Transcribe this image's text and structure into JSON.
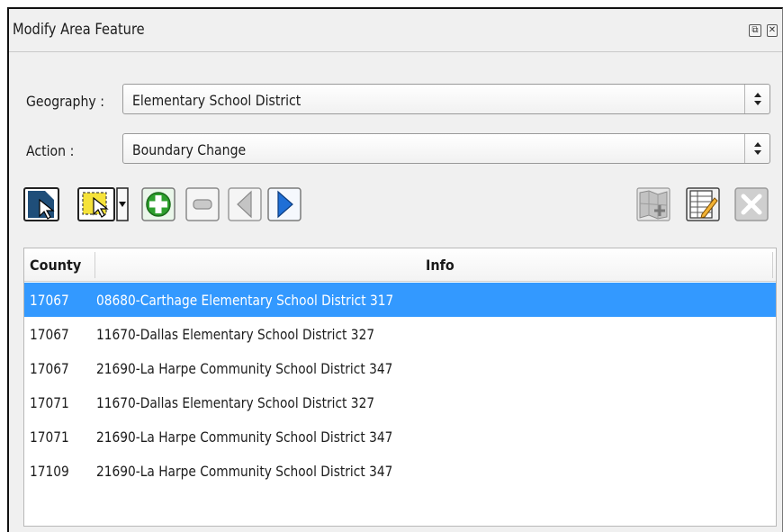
{
  "window": {
    "title": "Modify Area Feature",
    "float_glyph": "⧉",
    "close_glyph": "✕"
  },
  "form": {
    "geography": {
      "label": "Geography :",
      "value": "Elementary School District"
    },
    "action": {
      "label": "Action :",
      "value": "Boundary Change"
    }
  },
  "toolbar": {
    "icons": [
      "select-feature-icon",
      "rectangle-select-icon",
      "dropdown-arrow-icon",
      "add-icon",
      "remove-icon",
      "previous-icon",
      "next-icon",
      "map-edit-icon",
      "table-edit-icon",
      "close-icon"
    ]
  },
  "table": {
    "columns": [
      "County",
      "Info"
    ],
    "rows": [
      {
        "county": "17067",
        "info": "08680-Carthage Elementary School District 317",
        "selected": true
      },
      {
        "county": "17067",
        "info": "11670-Dallas Elementary School District 327",
        "selected": false
      },
      {
        "county": "17067",
        "info": "21690-La Harpe Community School District 347",
        "selected": false
      },
      {
        "county": "17071",
        "info": "11670-Dallas Elementary School District 327",
        "selected": false
      },
      {
        "county": "17071",
        "info": "21690-La Harpe Community School District 347",
        "selected": false
      },
      {
        "county": "17109",
        "info": "21690-La Harpe Community School District 347",
        "selected": false
      }
    ]
  },
  "colors": {
    "selection": "#3399ff",
    "add_green": "#2da02d",
    "next_blue": "#1f6fd6"
  }
}
